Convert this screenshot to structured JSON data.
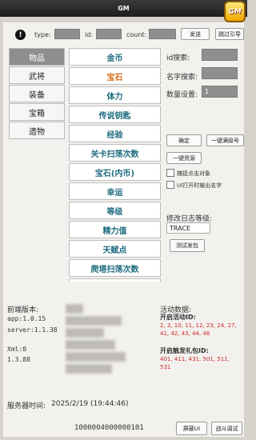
{
  "title": "GM",
  "badge": "GM",
  "filter": {
    "type_label": "type:",
    "id_label": "id:",
    "count_label": "count:",
    "send_button": "发送",
    "jump_button": "跳过引导"
  },
  "tabs": [
    "物品",
    "武将",
    "装备",
    "宝箱",
    "遗物"
  ],
  "categories": [
    "金币",
    "宝石",
    "体力",
    "传说钥匙",
    "经验",
    "关卡扫荡次数",
    "宝石(内币)",
    "幸运",
    "等级",
    "精力值",
    "天赋点",
    "爬塔扫荡次数",
    "..."
  ],
  "selected_category": "宝石",
  "search": {
    "id_label": "id搜索:",
    "name_label": "名字搜索:",
    "qty_label": "数量设置:",
    "qty_value": "1"
  },
  "actions": {
    "confirm": "确定",
    "max_account": "一键满级号",
    "all_resources": "一键资源",
    "click_object": "捕捉点击对象",
    "ui_open_name": "UI打开时输出名字",
    "log_level_label": "修改日志等级:",
    "log_level_value": "TRACE",
    "test_packet": "测试发包"
  },
  "info": {
    "front_version_label": "前端版本:",
    "app_version": "app:1.0.15",
    "server_version": "server:1.1.38",
    "xml_label": "Xml:0",
    "xml_version": "1.3.88",
    "activity_title": "活动数据:",
    "open_activity_label": "开启活动ID:",
    "open_activity_ids": "2, 3, 10, 11, 12, 23, 24, 27, 41, 42, 43, 44, 46",
    "gift_pack_label": "开启触发礼包ID:",
    "gift_pack_ids": "401, 411, 431, 501, 511, 531",
    "server_time_label": "服务器时间:",
    "server_time": "2025/2/19 (19:44:46)",
    "player_id": "1000004000000101",
    "block_ui": "屏蔽UI",
    "battle_test": "战斗调试"
  }
}
